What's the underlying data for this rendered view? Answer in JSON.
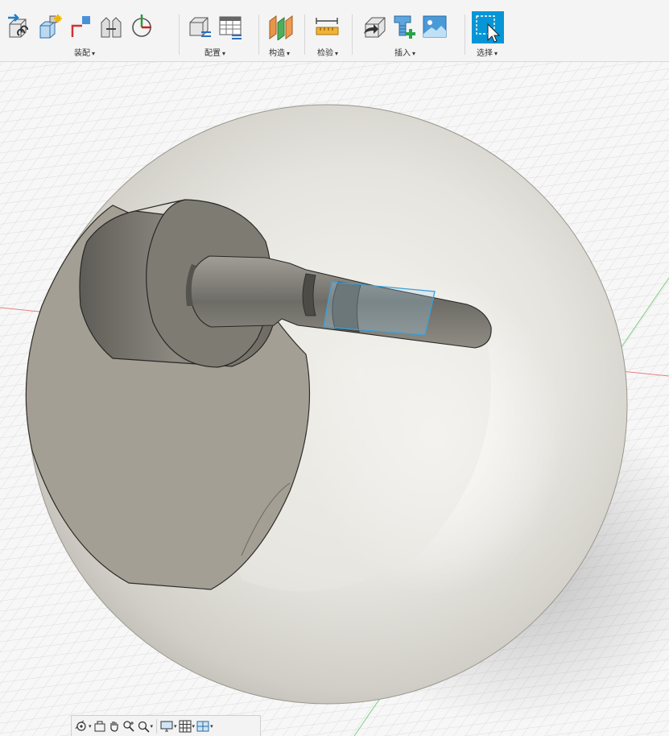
{
  "toolbar": {
    "groups": [
      {
        "label": "装配",
        "icons": [
          "new-component-icon",
          "joint-icon",
          "as-built-joint-icon",
          "rigid-group-icon",
          "drive-joints-icon"
        ]
      },
      {
        "label": "配置",
        "icons": [
          "configure-icon",
          "configuration-table-icon"
        ]
      },
      {
        "label": "构造",
        "icons": [
          "offset-plane-icon"
        ]
      },
      {
        "label": "检验",
        "icons": [
          "measure-icon"
        ]
      },
      {
        "label": "插入",
        "icons": [
          "insert-derive-icon",
          "insert-mcmaster-icon",
          "insert-canvas-icon"
        ]
      },
      {
        "label": "选择",
        "icons": [
          "select-icon"
        ]
      }
    ],
    "caret": "▾"
  },
  "navbar": {
    "items": [
      "orbit-icon",
      "look-at-icon",
      "pan-icon",
      "zoom-icon",
      "fit-icon",
      "display-settings-icon",
      "grid-settings-icon",
      "viewports-icon"
    ],
    "caret": "▾"
  },
  "colors": {
    "accent": "#0696d7",
    "model": "#dedcd6",
    "cut_face": "#a09d92",
    "grid": "#d8d8d8",
    "axis_red": "#e07070",
    "axis_green": "#7cc77c"
  }
}
